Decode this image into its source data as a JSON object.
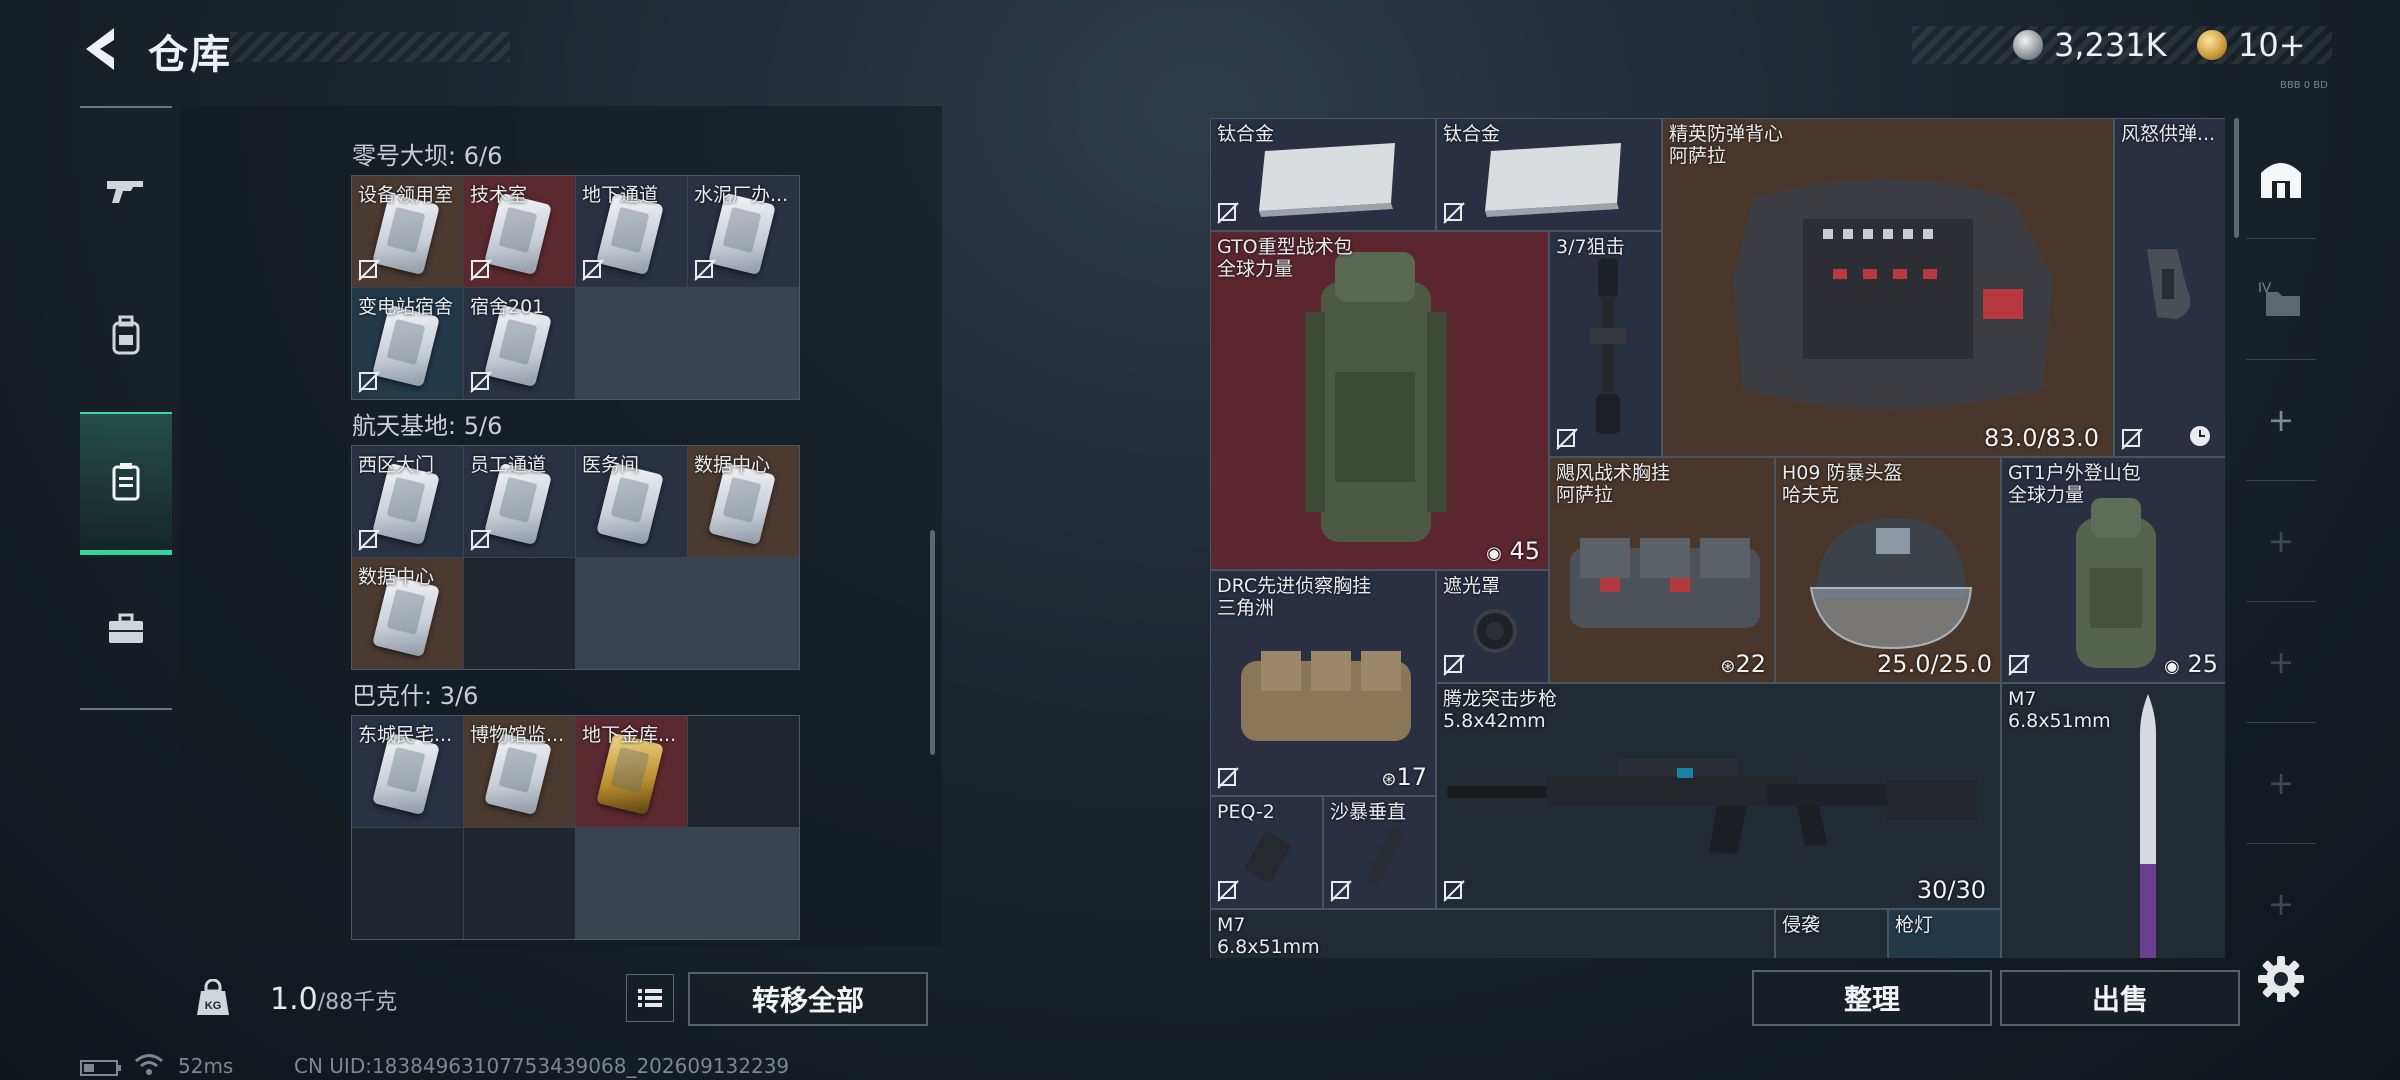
{
  "header": {
    "title": "仓库",
    "currency_silver": "3,231K",
    "currency_gold": "10+",
    "version_text": "BBB 0 BD"
  },
  "colors": {
    "accent_green": "#33d39c",
    "red_rarity": "#5b2630",
    "brown_rarity": "#4a372b",
    "navy_rarity": "#2a3041",
    "teal_rarity": "#23394a"
  },
  "nav": {
    "items": [
      {
        "name": "weapons",
        "icon": "gun-icon"
      },
      {
        "name": "armor",
        "icon": "backpack-icon"
      },
      {
        "name": "keycards",
        "icon": "keycard-icon",
        "active": true
      },
      {
        "name": "supplies",
        "icon": "toolbox-icon"
      }
    ]
  },
  "left_panel": {
    "sections": [
      {
        "title": "零号大坝: 6/6",
        "cells": [
          {
            "label": "设备领用室",
            "tone": "brown"
          },
          {
            "label": "技术室",
            "tone": "red"
          },
          {
            "label": "地下通道",
            "tone": "navy"
          },
          {
            "label": "水泥厂办...",
            "tone": "navy"
          },
          {
            "label": "变电站宿舍",
            "tone": "teal"
          },
          {
            "label": "宿舍201",
            "tone": "navy"
          }
        ]
      },
      {
        "title": "航天基地: 5/6",
        "cells": [
          {
            "label": "西区大门",
            "tone": "navy"
          },
          {
            "label": "员工通道",
            "tone": "navy"
          },
          {
            "label": "医务间",
            "tone": "navy"
          },
          {
            "label": "数据中心",
            "tone": "brown"
          },
          {
            "label": "数据中心",
            "tone": "brown"
          }
        ]
      },
      {
        "title": "巴克什: 3/6",
        "cells": [
          {
            "label": "东城民宅...",
            "tone": "navy"
          },
          {
            "label": "博物馆监...",
            "tone": "brown"
          },
          {
            "label": "地下金库...",
            "tone": "red",
            "gold": true
          }
        ]
      }
    ],
    "weight_value": "1.0",
    "weight_max": "/88千克",
    "transfer_all": "转移全部"
  },
  "stash": {
    "items": [
      {
        "id": "titanium-1",
        "label": "钛合金"
      },
      {
        "id": "titanium-2",
        "label": "钛合金"
      },
      {
        "id": "elite-vest",
        "label": "精英防弹背心\n阿萨拉",
        "value": "83.0/83.0"
      },
      {
        "id": "fury-ammo",
        "label": "风怒供弹..."
      },
      {
        "id": "gto-pack",
        "label": "GTO重型战术包\n全球力量",
        "value": "45"
      },
      {
        "id": "scope-37",
        "label": "3/7狙击"
      },
      {
        "id": "storm-rig",
        "label": "飓风战术胸挂\n阿萨拉",
        "value": "22"
      },
      {
        "id": "h09-helmet",
        "label": "H09 防暴头盔\n哈夫克",
        "value": "25.0/25.0"
      },
      {
        "id": "gt1-pack",
        "label": "GT1户外登山包\n全球力量",
        "value": "25"
      },
      {
        "id": "drc-rig",
        "label": "DRC先进侦察胸挂\n三角洲",
        "value": "17"
      },
      {
        "id": "light-shade",
        "label": "遮光罩"
      },
      {
        "id": "tenglong-rifle",
        "label": "腾龙突击步枪\n5.8x42mm",
        "value": "30/30"
      },
      {
        "id": "m7-ammo-1",
        "label": "M7\n6.8x51mm"
      },
      {
        "id": "peq2",
        "label": "PEQ-2"
      },
      {
        "id": "sandstorm-grip",
        "label": "沙暴垂直"
      },
      {
        "id": "m7-ammo-2",
        "label": "M7\n6.8x51mm"
      },
      {
        "id": "raid",
        "label": "侵袭"
      },
      {
        "id": "gun-light",
        "label": "枪灯"
      }
    ],
    "sort_label": "整理",
    "sell_label": "出售"
  },
  "status_bar": {
    "ping": "52ms",
    "uid": "CN UID:18384963107753439068_202609132239"
  }
}
